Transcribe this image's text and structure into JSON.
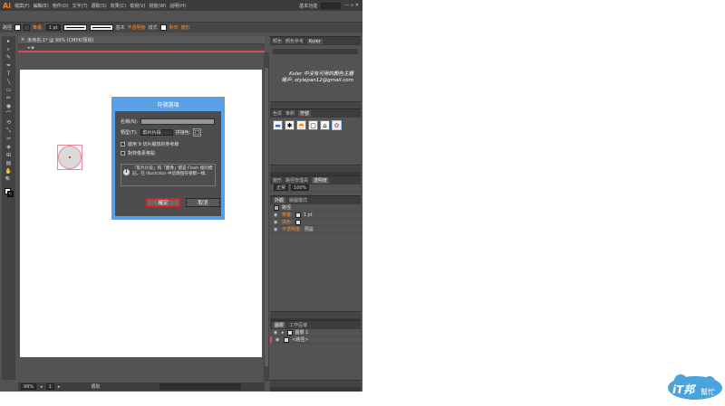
{
  "app": {
    "logo": "Ai",
    "menus": [
      "檔案(F)",
      "編輯(E)",
      "物件(O)",
      "文字(T)",
      "選取(S)",
      "效果(C)",
      "檢視(V)",
      "視窗(W)",
      "說明(H)"
    ],
    "workspace": "基本功能"
  },
  "control_bar": {
    "selection_label": "路徑",
    "stroke_label": "筆畫:",
    "stroke_value": "1 pt",
    "uniform_label": "基本",
    "opacity_label": "不透明度",
    "style_label": "樣式",
    "align_label": "對齊",
    "transform_label": "變形"
  },
  "document": {
    "tab_title": "未命名-1* @ 99% (CMYK/預視)",
    "zoom": "99%",
    "page": "1",
    "status": "選取"
  },
  "tools": [
    "▸",
    "▹",
    "✎",
    "✒",
    "T",
    "╲",
    "▭",
    "✏",
    "◉",
    "⌒",
    "⟲",
    "⤡",
    "✂",
    "◈",
    "⊞",
    "▤",
    "✋",
    "🔍"
  ],
  "panels": {
    "top_tabs": [
      "顏色",
      "顏色參考",
      "Kuler"
    ],
    "kuler_line1": "Kuler 中沒有可用的顏色主題",
    "kuler_line2": "帳戶: stylepan12@gmail.com",
    "symbols_tabs": [
      "色票",
      "筆刷",
      "符號"
    ],
    "symbols": [
      "▬",
      "✱",
      "◓",
      "▢",
      "⌂",
      "✿"
    ],
    "transform_tabs": [
      "變形",
      "路徑管理員",
      "透明度"
    ],
    "blend_mode": "正常",
    "opacity": "100%",
    "appearance_tabs": [
      "外觀",
      "繪圖樣式"
    ],
    "appearance_title": "路徑",
    "appearance_rows": [
      {
        "label": "筆畫:",
        "value": "1 pt"
      },
      {
        "label": "填色:",
        "value": ""
      },
      {
        "label": "不透明度:",
        "value": "預設"
      }
    ],
    "layers_tabs": [
      "圖層",
      "工作區域"
    ],
    "layers": [
      {
        "name": "圖層 1"
      },
      {
        "name": "<路徑>"
      }
    ]
  },
  "dialog": {
    "title": "符號選項",
    "name_label": "名稱(N):",
    "name_value": "",
    "type_label": "類型(T):",
    "type_value": "影片片段",
    "registration_label": "拼接色:",
    "guides_label": "啟用 9 切片縮放的參考線",
    "align_label": "對齊像素格點",
    "info_text": "「影片片段」和「圖像」都是 Flash 裡的標記。在 Illustrator 中這兩個符號都一樣。",
    "ok_label": "確定",
    "cancel_label": "取消"
  },
  "watermark": {
    "text1": "iT邦",
    "text2": "幫忙"
  },
  "colors": {
    "accent_orange": "#ff7f18",
    "dialog_blue": "#5b9fe5",
    "highlight_red": "#e0202a"
  }
}
